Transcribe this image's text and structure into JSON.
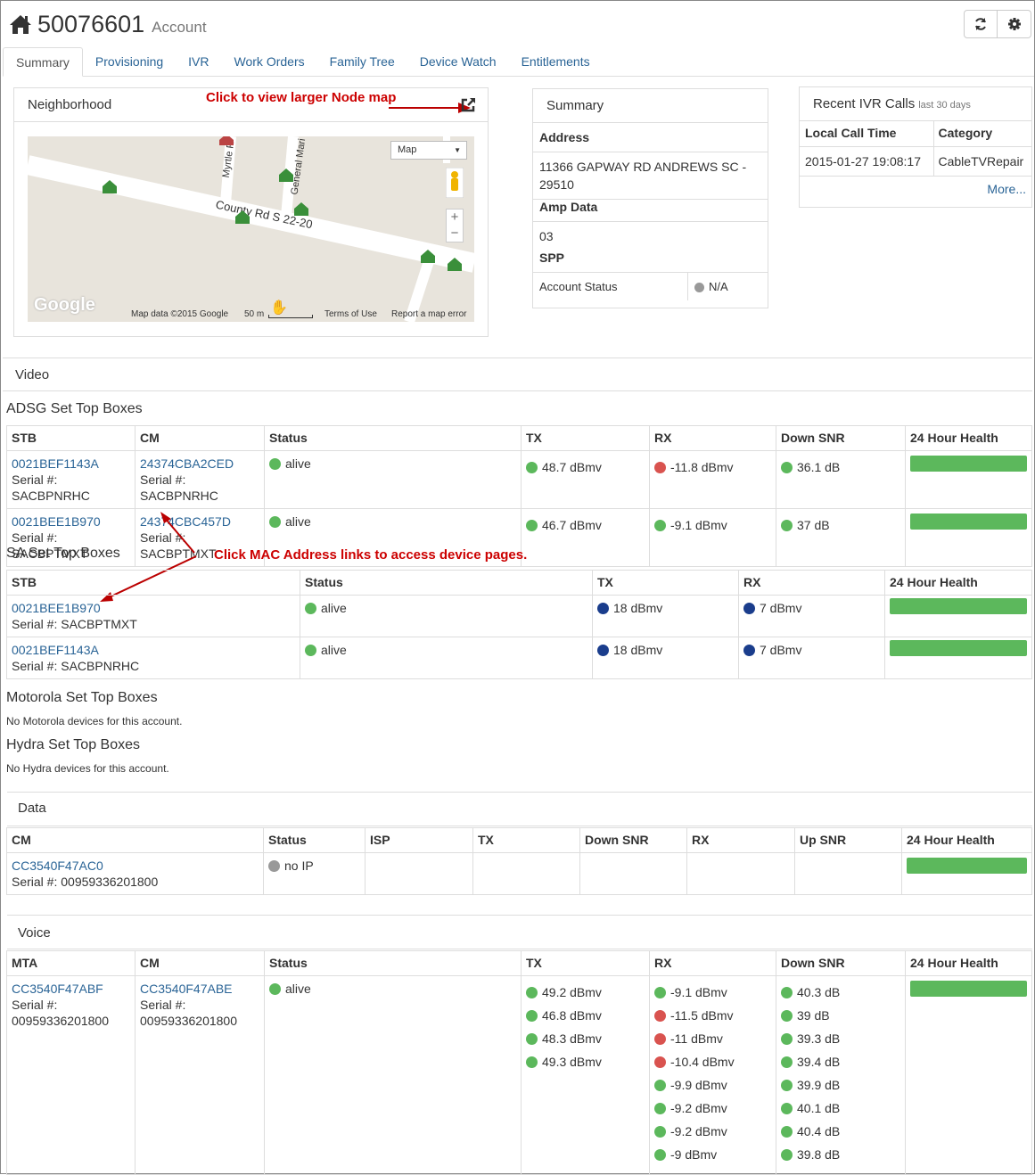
{
  "header": {
    "account_number": "50076601",
    "account_label": "Account"
  },
  "tabs": [
    "Summary",
    "Provisioning",
    "IVR",
    "Work Orders",
    "Family Tree",
    "Device Watch",
    "Entitlements"
  ],
  "neighborhood": {
    "title": "Neighborhood",
    "annotation": "Click to view larger Node map",
    "map_type": "Map",
    "road": "County Rd S 22-20",
    "streets": [
      "Myrtle R",
      "General Mari"
    ],
    "footer": {
      "brand": "Google",
      "data": "Map data ©2015 Google",
      "scale": "50 m",
      "terms": "Terms of Use",
      "report": "Report a map error"
    }
  },
  "summary": {
    "title": "Summary",
    "address_label": "Address",
    "address": "11366 GAPWAY RD ANDREWS SC - 29510",
    "amp_label": "Amp Data",
    "amp": "03",
    "spp_label": "SPP",
    "status_label": "Account Status",
    "status": "N/A"
  },
  "ivr": {
    "title": "Recent IVR Calls",
    "subtitle": "last 30 days",
    "col_time": "Local Call Time",
    "col_cat": "Category",
    "time": "2015-01-27 19:08:17",
    "category": "CableTVRepair",
    "more": "More..."
  },
  "video": {
    "title": "Video",
    "adsg": {
      "title": "ADSG Set Top Boxes",
      "headers": [
        "STB",
        "CM",
        "Status",
        "TX",
        "RX",
        "Down SNR",
        "24 Hour Health"
      ],
      "rows": [
        {
          "stb": "0021BEF1143A",
          "stb_serial": "Serial #: SACBPNRHC",
          "cm": "24374CBA2CED",
          "cm_serial": "Serial #: SACBPNRHC",
          "status": "alive",
          "tx": "48.7 dBmv",
          "rx": "-11.8 dBmv",
          "snr": "36.1 dB"
        },
        {
          "stb": "0021BEE1B970",
          "stb_serial": "Serial #: SACBPTMXT",
          "cm": "24374CBC457D",
          "cm_serial": "Serial #: SACBPTMXT",
          "status": "alive",
          "tx": "46.7 dBmv",
          "rx": "-9.1 dBmv",
          "snr": "37 dB"
        }
      ]
    },
    "sa": {
      "title": "SA Set Top Boxes",
      "annotation": "Click  MAC Address links to access device pages.",
      "headers": [
        "STB",
        "Status",
        "TX",
        "RX",
        "24 Hour Health"
      ],
      "rows": [
        {
          "stb": "0021BEE1B970",
          "serial": "Serial #: SACBPTMXT",
          "status": "alive",
          "tx": "18 dBmv",
          "rx": "7 dBmv"
        },
        {
          "stb": "0021BEF1143A",
          "serial": "Serial #: SACBPNRHC",
          "status": "alive",
          "tx": "18 dBmv",
          "rx": "7 dBmv"
        }
      ]
    },
    "motorola": {
      "title": "Motorola Set Top Boxes",
      "note": "No Motorola devices for this account."
    },
    "hydra": {
      "title": "Hydra Set Top Boxes",
      "note": "No Hydra devices for this account."
    }
  },
  "data": {
    "title": "Data",
    "headers": [
      "CM",
      "Status",
      "ISP",
      "TX",
      "Down SNR",
      "RX",
      "Up SNR",
      "24 Hour Health"
    ],
    "row": {
      "cm": "CC3540F47AC0",
      "serial": "Serial #: 00959336201800",
      "status": "no IP"
    }
  },
  "voice": {
    "title": "Voice",
    "headers": [
      "MTA",
      "CM",
      "Status",
      "TX",
      "RX",
      "Down SNR",
      "24 Hour Health"
    ],
    "row": {
      "mta": "CC3540F47ABF",
      "mta_serial_label": "Serial #:",
      "mta_serial": "00959336201800",
      "cm": "CC3540F47ABE",
      "cm_serial_label": "Serial #:",
      "cm_serial": "00959336201800",
      "status": "alive",
      "tx": [
        "49.2 dBmv",
        "46.8 dBmv",
        "48.3 dBmv",
        "49.3 dBmv"
      ],
      "rx": [
        "-9.1 dBmv",
        "-11.5 dBmv",
        "-11 dBmv",
        "-10.4 dBmv",
        "-9.9 dBmv",
        "-9.2 dBmv",
        "-9.2 dBmv",
        "-9 dBmv"
      ],
      "rx_status": [
        "g",
        "r",
        "r",
        "r",
        "g",
        "g",
        "g",
        "g"
      ],
      "snr": [
        "40.3 dB",
        "39 dB",
        "39.3 dB",
        "39.4 dB",
        "39.9 dB",
        "40.1 dB",
        "40.4 dB",
        "39.8 dB"
      ]
    }
  }
}
